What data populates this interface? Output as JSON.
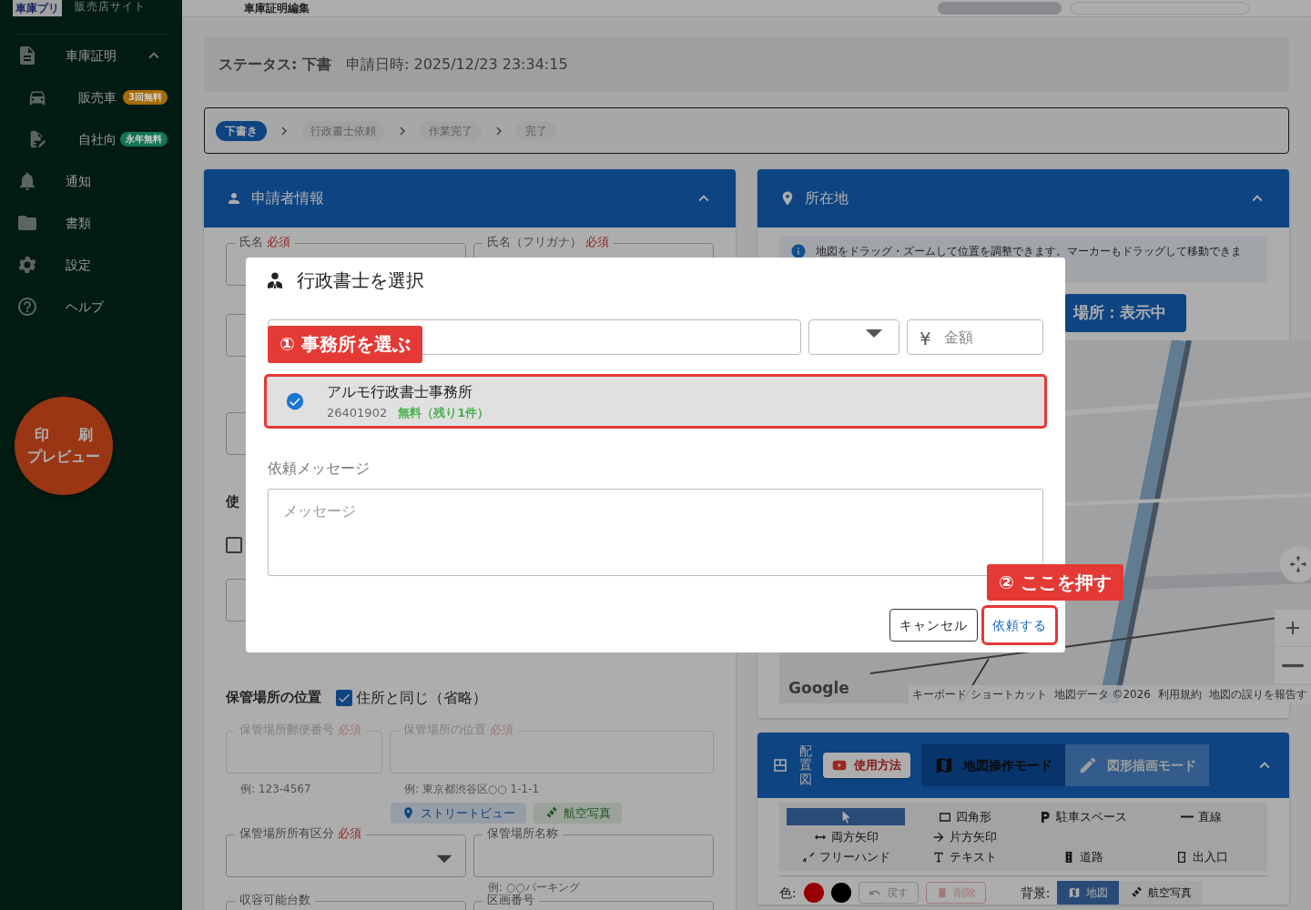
{
  "app": {
    "logo": "車庫プリ",
    "site_name": "販売店サイト",
    "page_title": "車庫証明編集"
  },
  "sidebar": {
    "items": [
      {
        "label": "車庫証明",
        "expanded": true,
        "children": [
          {
            "label": "販売車",
            "badge": "3回無料",
            "color": "#a76b07"
          },
          {
            "label": "自社向",
            "badge": "永年無料",
            "color": "#157653"
          }
        ]
      },
      {
        "label": "通知"
      },
      {
        "label": "書類"
      },
      {
        "label": "設定"
      },
      {
        "label": "ヘルプ"
      }
    ]
  },
  "print_preview": {
    "lines": [
      "印　　刷",
      "プレビュー"
    ]
  },
  "status": {
    "label": "ステータス: 下書",
    "date": "申請日時: 2025/12/23 23:34:15"
  },
  "steps": [
    {
      "label": "下書き",
      "selected": true
    },
    {
      "label": "行政書士依頼",
      "selected": false
    },
    {
      "label": "作業完了",
      "selected": false
    },
    {
      "label": "完了",
      "selected": false
    }
  ],
  "applicant": {
    "title": "申請者情報",
    "expanded": true,
    "fields": [
      {
        "label": "氏名",
        "required": "必須"
      },
      {
        "label": "氏名（フリガナ）",
        "required": "必須"
      }
    ],
    "section_fragment": "使",
    "checkbox": {
      "checked": false
    }
  },
  "storage": {
    "title": "保管場所の位置",
    "same_as_address": {
      "label": "住所と同じ（省略）",
      "checked": true
    },
    "fields": [
      {
        "label": "保管場所郵便番号",
        "required": "必須",
        "hint": "例: 123-4567",
        "disabled": true
      },
      {
        "label": "保管場所の位置",
        "required": "必須",
        "hint": "例: 東京都渋谷区○○ 1-1-1",
        "disabled": true
      }
    ],
    "buttons": [
      {
        "label": "ストリートビュー",
        "kind": "street"
      },
      {
        "label": "航空写真",
        "kind": "aerial"
      }
    ],
    "fields2": [
      {
        "label": "保管場所所有区分",
        "required": "必須",
        "kind": "select"
      },
      {
        "label": "保管場所名称",
        "hint": "例: ○○パーキング",
        "kind": "text"
      },
      {
        "label": "収容可能台数",
        "kind": "text"
      },
      {
        "label": "区画番号",
        "kind": "text"
      }
    ]
  },
  "location": {
    "title": "所在地",
    "expanded": true,
    "notice": "地図をドラッグ・ズームして位置を調整できます。マーカーもドラッグして移動できま",
    "toggle_button": "場所：表示中",
    "map": {
      "logo": "Google",
      "attribution": [
        "キーボード ショートカット",
        "地図データ ©2026",
        "利用規約",
        "地図の誤りを報告す"
      ]
    }
  },
  "layout_card": {
    "title": "配置図",
    "help_button": "使用方法",
    "expanded": true,
    "modes": [
      {
        "label": "地図操作モード",
        "selected": true
      },
      {
        "label": "図形描画モード",
        "selected": false
      }
    ],
    "tools": [
      {
        "kind": "select",
        "selected": true
      },
      {
        "kind": "rectangle",
        "label": "四角形",
        "selected": false
      },
      {
        "kind": "parking",
        "label": "駐車スペース",
        "selected": false
      },
      {
        "kind": "line",
        "label": "直線",
        "selected": false
      },
      {
        "kind": "double-arrow",
        "label": "両方矢印",
        "selected": false
      },
      {
        "kind": "arrow",
        "label": "片方矢印",
        "selected": false
      },
      {
        "kind": "freehand",
        "label": "フリーハンド",
        "selected": false
      },
      {
        "kind": "text",
        "label": "テキスト",
        "selected": false
      },
      {
        "kind": "road",
        "label": "道路",
        "selected": false
      },
      {
        "kind": "entrance",
        "label": "出入口",
        "selected": false
      }
    ],
    "colors_label": "色:",
    "colors": [
      {
        "color": "#980000"
      },
      {
        "color": "#000000"
      }
    ],
    "actions": [
      {
        "label": "戻す",
        "disabled": true
      },
      {
        "label": "削除",
        "disabled": true
      }
    ],
    "background_label": "背景:",
    "backgrounds": [
      {
        "label": "地図",
        "selected": true
      },
      {
        "label": "航空写真",
        "selected": false
      }
    ]
  },
  "dialog": {
    "title": "行政書士を選択",
    "currency_symbol": "¥",
    "amount_placeholder": "金額",
    "callouts": [
      "① 事務所を選ぶ",
      "② ここを押す"
    ],
    "offices": [
      {
        "name": "アルモ行政書士事務所",
        "code": "26401902",
        "price": "無料（残り1件）",
        "selected": true
      }
    ],
    "message_label": "依頼メッセージ",
    "message_placeholder": "メッセージ",
    "buttons": [
      {
        "label": "キャンセル",
        "kind": "cancel"
      },
      {
        "label": "依頼する",
        "kind": "submit"
      }
    ]
  }
}
